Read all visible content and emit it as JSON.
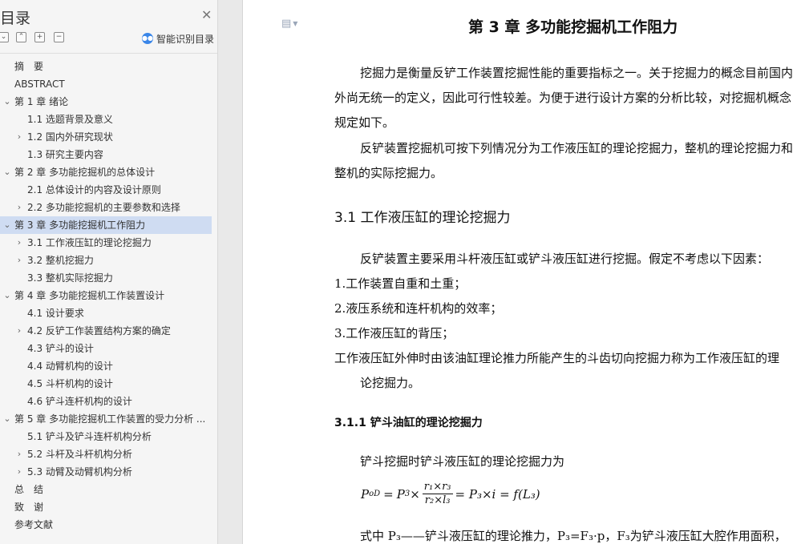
{
  "sidebar": {
    "title": "目录",
    "ai_label": "智能识别目录",
    "toc": [
      {
        "label": "摘　要",
        "level": 0,
        "caret": "none",
        "active": false
      },
      {
        "label": "ABSTRACT",
        "level": 0,
        "caret": "none",
        "active": false
      },
      {
        "label": "第 1 章 绪论",
        "level": 0,
        "caret": "down",
        "active": false
      },
      {
        "label": "1.1 选题背景及意义",
        "level": 1,
        "caret": "none",
        "active": false
      },
      {
        "label": "1.2 国内外研究现状",
        "level": 1,
        "caret": "right",
        "active": false
      },
      {
        "label": "1.3 研究主要内容",
        "level": 1,
        "caret": "none",
        "active": false
      },
      {
        "label": "第 2 章 多功能挖掘机的总体设计",
        "level": 0,
        "caret": "down",
        "active": false
      },
      {
        "label": "2.1 总体设计的内容及设计原则",
        "level": 1,
        "caret": "none",
        "active": false
      },
      {
        "label": "2.2 多功能挖掘机的主要参数和选择",
        "level": 1,
        "caret": "right",
        "active": false
      },
      {
        "label": "第 3 章 多功能挖掘机工作阻力",
        "level": 0,
        "caret": "down",
        "active": true
      },
      {
        "label": "3.1 工作液压缸的理论挖掘力",
        "level": 1,
        "caret": "right",
        "active": false
      },
      {
        "label": "3.2 整机挖掘力",
        "level": 1,
        "caret": "right",
        "active": false
      },
      {
        "label": "3.3 整机实际挖掘力",
        "level": 1,
        "caret": "none",
        "active": false
      },
      {
        "label": "第 4 章 多功能挖掘机工作装置设计",
        "level": 0,
        "caret": "down",
        "active": false
      },
      {
        "label": "4.1 设计要求",
        "level": 1,
        "caret": "none",
        "active": false
      },
      {
        "label": "4.2 反铲工作装置结构方案的确定",
        "level": 1,
        "caret": "right",
        "active": false
      },
      {
        "label": "4.3 铲斗的设计",
        "level": 1,
        "caret": "none",
        "active": false
      },
      {
        "label": "4.4 动臂机构的设计",
        "level": 1,
        "caret": "none",
        "active": false
      },
      {
        "label": "4.5 斗杆机构的设计",
        "level": 1,
        "caret": "none",
        "active": false
      },
      {
        "label": "4.6 铲斗连杆机构的设计",
        "level": 1,
        "caret": "none",
        "active": false
      },
      {
        "label": "第 5 章 多功能挖掘机工作装置的受力分析 ...",
        "level": 0,
        "caret": "down",
        "active": false
      },
      {
        "label": "5.1 铲斗及铲斗连杆机构分析",
        "level": 1,
        "caret": "none",
        "active": false
      },
      {
        "label": "5.2 斗杆及斗杆机构分析",
        "level": 1,
        "caret": "right",
        "active": false
      },
      {
        "label": "5.3 动臂及动臂机构分析",
        "level": 1,
        "caret": "right",
        "active": false
      },
      {
        "label": "总　结",
        "level": 0,
        "caret": "none",
        "active": false
      },
      {
        "label": "致　谢",
        "level": 0,
        "caret": "none",
        "active": false
      },
      {
        "label": "参考文献",
        "level": 0,
        "caret": "none",
        "active": false
      }
    ]
  },
  "document": {
    "chapter_title": "第 3 章  多功能挖掘机工作阻力",
    "para1": [
      "挖掘力是衡量反铲工作装置挖掘性能的重要指标之一。关于挖掘力的概念目前国内",
      "外尚无统一的定义，因此可行性较差。为便于进行设计方案的分析比较，对挖掘机概念",
      "规定如下。"
    ],
    "para2": [
      "反铲装置挖掘机可按下列情况分为工作液压缸的理论挖掘力，整机的理论挖掘力和",
      "整机的实际挖掘力。"
    ],
    "h2": "3.1  工作液压缸的理论挖掘力",
    "para3": "反铲装置主要采用斗杆液压缸或铲斗液压缸进行挖掘。假定不考虑以下因素：",
    "list": [
      "1.工作装置自重和土重；",
      "2.液压系统和连杆机构的效率；",
      "3.工作液压缸的背压；"
    ],
    "para4": [
      "工作液压缸外伸时由该油缸理论推力所能产生的斗齿切向挖掘力称为工作液压缸的理",
      "论挖掘力。"
    ],
    "h3": "3.1.1 铲斗油缸的理论挖掘力",
    "para5": "铲斗挖掘时铲斗液压缸的理论挖掘力为",
    "formula": {
      "lhs": "P",
      "lhs_sub": "oD",
      "p3": "P",
      "p3_sub": "3",
      "times": "×",
      "num": "r₁×r₃",
      "den": "r₂×l₃",
      "mid": "= P₃×i = f(L₃)"
    },
    "para6": "式中 P₃——铲斗液压缸的理论推力，P₃=F₃·p，F₃为铲斗液压缸大腔作用面积，"
  }
}
